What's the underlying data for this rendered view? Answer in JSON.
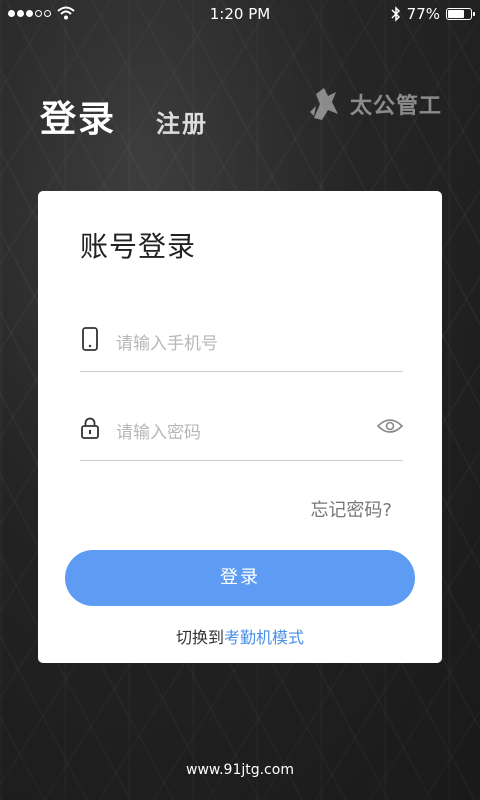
{
  "status_bar": {
    "signal_dots_filled": 3,
    "signal_dots_total": 5,
    "time": "1:20 PM",
    "battery_percent": "77%",
    "battery_level": 0.77
  },
  "header": {
    "tab_login": "登录",
    "tab_register": "注册",
    "logo_text": "太公管工"
  },
  "card": {
    "title": "账号登录",
    "phone_placeholder": "请输入手机号",
    "password_placeholder": "请输入密码",
    "forgot_password": "忘记密码?",
    "login_button": "登录",
    "switch_prefix": "切换到",
    "switch_link": "考勤机模式"
  },
  "footer": {
    "url": "www.91jtg.com"
  },
  "colors": {
    "accent": "#5d9cf2",
    "link": "#4a8fe8"
  },
  "icons": [
    "wifi-icon",
    "bluetooth-icon",
    "battery-icon",
    "phone-icon",
    "lock-icon",
    "eye-icon",
    "logo-icon"
  ]
}
